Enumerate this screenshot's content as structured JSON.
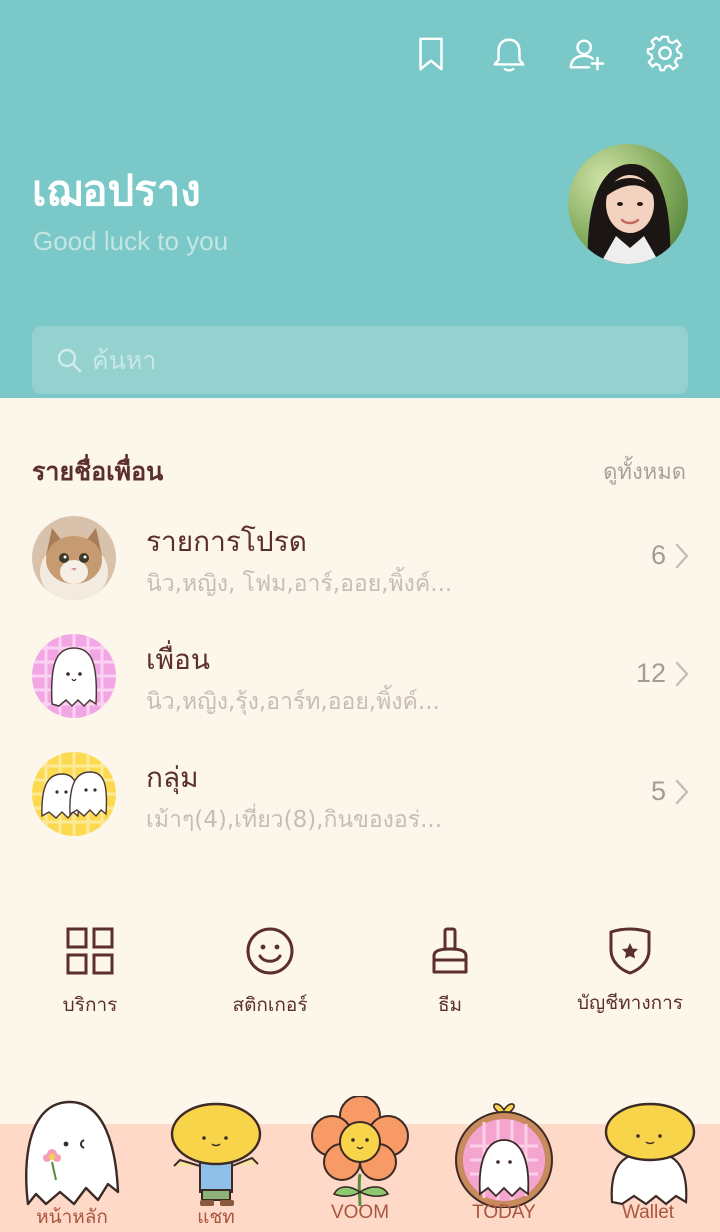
{
  "colors": {
    "header_bg": "#7ac8c8",
    "body_bg": "#fdf6ea",
    "tabbar_bg": "#ffd9c8",
    "text_brown": "#5b2f2c",
    "muted": "#c8bdb6"
  },
  "header": {
    "icons": [
      "bookmark-icon",
      "bell-icon",
      "add-friend-icon",
      "settings-icon"
    ]
  },
  "profile": {
    "name": "เฌอปราง",
    "status": "Good luck to you"
  },
  "search": {
    "placeholder": "ค้นหา"
  },
  "friends_section": {
    "title": "รายชื่อเพื่อน",
    "see_all": "ดูทั้งหมด",
    "groups": [
      {
        "title": "รายการโปรด",
        "members": "นิว,หญิง, โฟม,อาร์,ออย,พิ้งค์...",
        "count": "6"
      },
      {
        "title": "เพื่อน",
        "members": "นิว,หญิง,รุ้ง,อาร์ท,ออย,พิ้งค์...",
        "count": "12"
      },
      {
        "title": "กลุ่ม",
        "members": "เม้าๆ(4),เที่ยว(8),กินของอร่...",
        "count": "5"
      }
    ]
  },
  "quick_menu": [
    {
      "label": "บริการ",
      "icon": "grid-icon"
    },
    {
      "label": "สติกเกอร์",
      "icon": "smiley-icon"
    },
    {
      "label": "ธีม",
      "icon": "brush-icon"
    },
    {
      "label": "บัญชีทางการ",
      "icon": "shield-star-icon"
    }
  ],
  "tabs": [
    {
      "label": "หน้าหลัก",
      "icon": "ghost-home-icon"
    },
    {
      "label": "แชท",
      "icon": "lemon-kid-chat-icon"
    },
    {
      "label": "VOOM",
      "icon": "flower-voom-icon"
    },
    {
      "label": "TODAY",
      "icon": "ghost-frame-today-icon"
    },
    {
      "label": "Wallet",
      "icon": "lemon-ghost-wallet-icon"
    }
  ]
}
